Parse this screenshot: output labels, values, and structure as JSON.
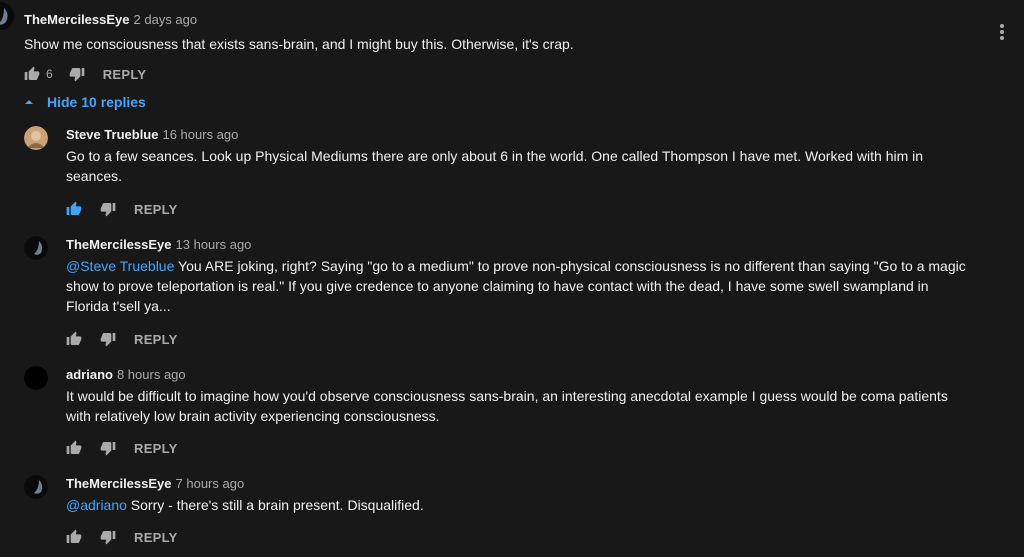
{
  "top": {
    "author": "TheMercilessEye",
    "time": "2 days ago",
    "text": "Show me consciousness that exists sans-brain, and I might buy this.  Otherwise, it's crap.",
    "likes": "6",
    "reply_label": "REPLY"
  },
  "toggle_label": "Hide 10 replies",
  "replies": [
    {
      "author": "Steve Trueblue",
      "time": "16 hours ago",
      "mention": "",
      "text": "Go to a few seances. Look up Physical Mediums there are only about 6 in the world. One called Thompson I have met. Worked with him  in seances.",
      "reply_label": "REPLY"
    },
    {
      "author": "TheMercilessEye",
      "time": "13 hours ago",
      "mention": "@Steve Trueblue",
      "text": " You ARE joking, right?  Saying \"go to a medium\" to prove non-physical consciousness is no different than saying \"Go to a magic show to prove teleportation is real.\"  If you give credence to anyone claiming to have contact with the dead, I have some swell swampland in Florida t'sell ya...",
      "reply_label": "REPLY"
    },
    {
      "author": "adriano",
      "time": "8 hours ago",
      "mention": "",
      "text": "It would be difficult to imagine how you'd observe consciousness sans-brain, an interesting anecdotal example I guess would be coma patients with relatively low brain activity experiencing consciousness.",
      "reply_label": "REPLY"
    },
    {
      "author": "TheMercilessEye",
      "time": "7 hours ago",
      "mention": "@adriano",
      "text": " Sorry - there's still a brain present.  Disqualified.",
      "reply_label": "REPLY"
    }
  ],
  "colors": {
    "background": "#181818",
    "text": "#f1f1f1",
    "secondary": "#aaaaaa",
    "link": "#3ea6ff",
    "liked": "#3ea6ff"
  },
  "icons": [
    "thumb-up-icon",
    "thumb-down-icon",
    "more-vert-icon",
    "chevron-up-icon"
  ]
}
